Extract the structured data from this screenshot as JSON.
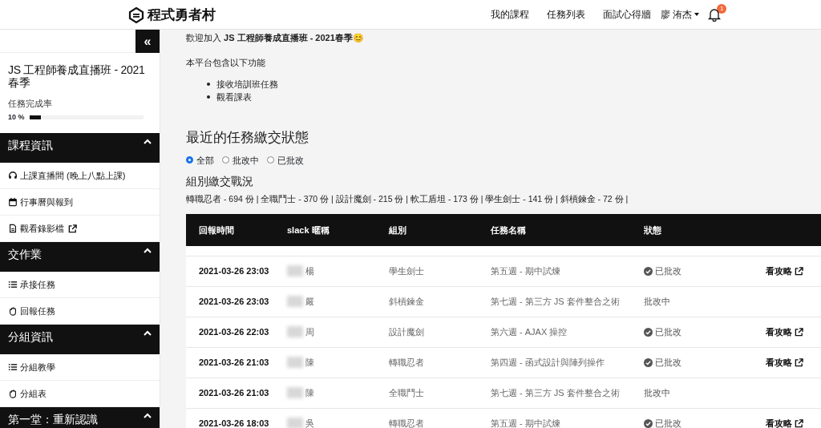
{
  "header": {
    "logo": "程式勇者村",
    "nav": [
      "我的課程",
      "任務列表",
      "面試心得牆"
    ],
    "user": "廖 洧杰",
    "notification_count": "1"
  },
  "sidebar": {
    "collapse": "«",
    "course_title": "JS 工程師養成直播班 - 2021 春季",
    "progress_label": "任務完成率",
    "progress_text": "10 %",
    "level": 0.1,
    "sections": [
      {
        "title": "課程資訊",
        "expanded": true,
        "items": [
          {
            "label": "上課直播間 (晚上八點上課)",
            "kind": "live",
            "external": false
          },
          {
            "label": "行事曆與報到",
            "kind": "calendar",
            "external": false
          },
          {
            "label": "觀看錄影檔",
            "kind": "video",
            "external": true
          }
        ]
      },
      {
        "title": "交作業",
        "expanded": true,
        "items": [
          {
            "label": "承接任務",
            "kind": "list",
            "external": false
          },
          {
            "label": "回報任務",
            "kind": "report",
            "external": false
          }
        ]
      },
      {
        "title": "分組資訊",
        "expanded": true,
        "items": [
          {
            "label": "分組教學",
            "kind": "list",
            "external": false
          },
          {
            "label": "分組表",
            "kind": "report",
            "external": false
          }
        ]
      },
      {
        "title": "第一堂：重新認識",
        "expanded": true
      }
    ]
  },
  "intro": {
    "welcome": "歡迎加入 **JS 工程師養成直播班 - 2021春季**😊",
    "features_title": "本平台包含以下功能",
    "features": [
      "接收培訓班任務",
      "觀看課表"
    ]
  },
  "status_section": {
    "title": "最近的任務繳交狀態",
    "filters": [
      {
        "label": "全部",
        "selected": true
      },
      {
        "label": "批改中",
        "selected": false
      },
      {
        "label": "已批改",
        "selected": false
      }
    ],
    "group_title": "組別繳交戰況",
    "group_stats": "轉職忍者 - 694 份 | 全職鬥士 - 370 份 | 設計魔劍 - 215 份 | 軟工盾坦 - 173 份 | 學生劍士 - 141 份 | 斜槓鍊金 - 72 份 |"
  },
  "table": {
    "columns": [
      "回報時間",
      "slack 暱稱",
      "組別",
      "任務名稱",
      "狀態"
    ],
    "rows": [
      {
        "time": "2021-03-26 23:03",
        "nickname": "楊",
        "group": "學生劍士",
        "task": "第五週 - 期中試煉",
        "status": "已批改",
        "graded": true,
        "link": "看攻略"
      },
      {
        "time": "2021-03-26 23:03",
        "nickname": "嚴",
        "group": "斜槓鍊金",
        "task": "第七週 - 第三方 JS 套件整合之術",
        "status": "批改中",
        "graded": false
      },
      {
        "time": "2021-03-26 22:03",
        "nickname": "周",
        "group": "設計魔劍",
        "task": "第六週 - AJAX 操控",
        "status": "已批改",
        "graded": true,
        "link": "看攻略"
      },
      {
        "time": "2021-03-26 21:03",
        "nickname": "陳",
        "group": "轉職忍者",
        "task": "第四週 - 函式設計與陣列操作",
        "status": "已批改",
        "graded": true,
        "link": "看攻略"
      },
      {
        "time": "2021-03-26 21:03",
        "nickname": "陳",
        "group": "全職鬥士",
        "task": "第七週 - 第三方 JS 套件整合之術",
        "status": "批改中",
        "graded": false
      },
      {
        "time": "2021-03-26 18:03",
        "nickname": "吳",
        "group": "轉職忍者",
        "task": "第五週 - 期中試煉",
        "status": "已批改",
        "graded": true,
        "link": "看攻略"
      }
    ]
  }
}
